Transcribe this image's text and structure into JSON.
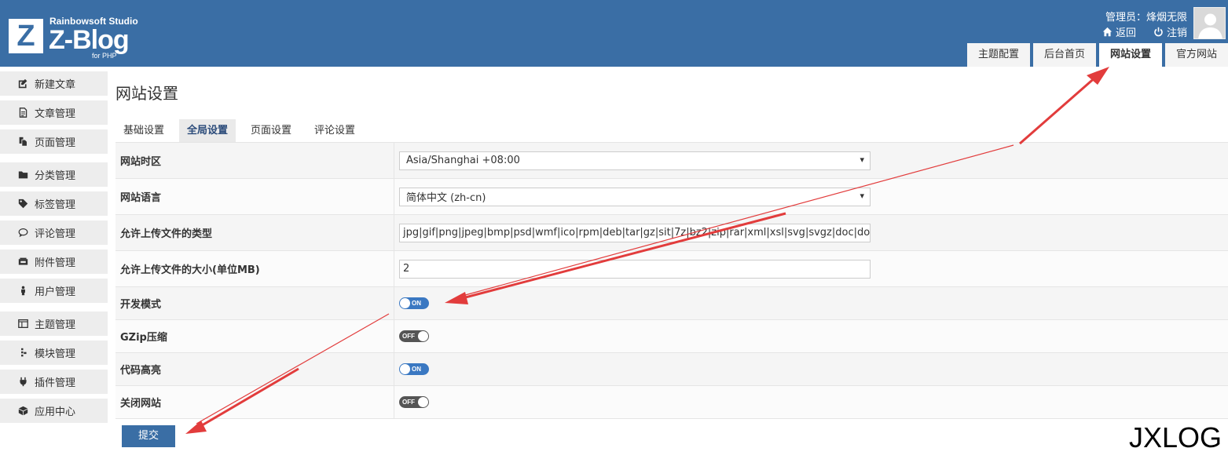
{
  "header": {
    "brand_studio": "Rainbowsoft Studio",
    "brand_name": "Z-Blog",
    "brand_sub": "for PHP",
    "brand_letter": "Z",
    "admin_label": "管理员：烽烟无限",
    "link_back": "返回",
    "link_logout": "注销",
    "top_tabs": [
      "主题配置",
      "后台首页",
      "网站设置",
      "官方网站"
    ]
  },
  "sidebar": {
    "items": [
      {
        "label": "新建文章",
        "icon": "edit-icon"
      },
      {
        "label": "文章管理",
        "icon": "article-icon"
      },
      {
        "label": "页面管理",
        "icon": "page-icon"
      },
      {
        "label": "分类管理",
        "icon": "folder-icon"
      },
      {
        "label": "标签管理",
        "icon": "tag-icon"
      },
      {
        "label": "评论管理",
        "icon": "comment-icon"
      },
      {
        "label": "附件管理",
        "icon": "attachment-icon"
      },
      {
        "label": "用户管理",
        "icon": "user-icon"
      },
      {
        "label": "主题管理",
        "icon": "theme-icon"
      },
      {
        "label": "模块管理",
        "icon": "module-icon"
      },
      {
        "label": "插件管理",
        "icon": "plugin-icon"
      },
      {
        "label": "应用中心",
        "icon": "app-center-icon"
      }
    ]
  },
  "main": {
    "title": "网站设置",
    "tabs": [
      "基础设置",
      "全局设置",
      "页面设置",
      "评论设置"
    ],
    "active_tab": "全局设置",
    "settings": {
      "timezone": {
        "label": "网站时区",
        "value": "Asia/Shanghai +08:00"
      },
      "language": {
        "label": "网站语言",
        "value": "简体中文 (zh-cn)"
      },
      "upload_types": {
        "label": "允许上传文件的类型",
        "value": "jpg|gif|png|jpeg|bmp|psd|wmf|ico|rpm|deb|tar|gz|sit|7z|bz2|zip|rar|xml|xsl|svg|svgz|doc|docx|p"
      },
      "upload_size": {
        "label": "允许上传文件的大小(单位MB)",
        "value": "2"
      },
      "dev_mode": {
        "label": "开发模式",
        "state": "ON"
      },
      "gzip": {
        "label": "GZip压缩",
        "state": "OFF"
      },
      "code_highlight": {
        "label": "代码高亮",
        "state": "ON"
      },
      "close_site": {
        "label": "关闭网站",
        "state": "OFF"
      }
    },
    "submit_label": "提交"
  },
  "watermark": "JXLOG",
  "colors": {
    "header_bg": "#3a6ea5",
    "toggle_on": "#3a78c2",
    "toggle_off": "#555555",
    "arrow": "#e23c3c"
  }
}
